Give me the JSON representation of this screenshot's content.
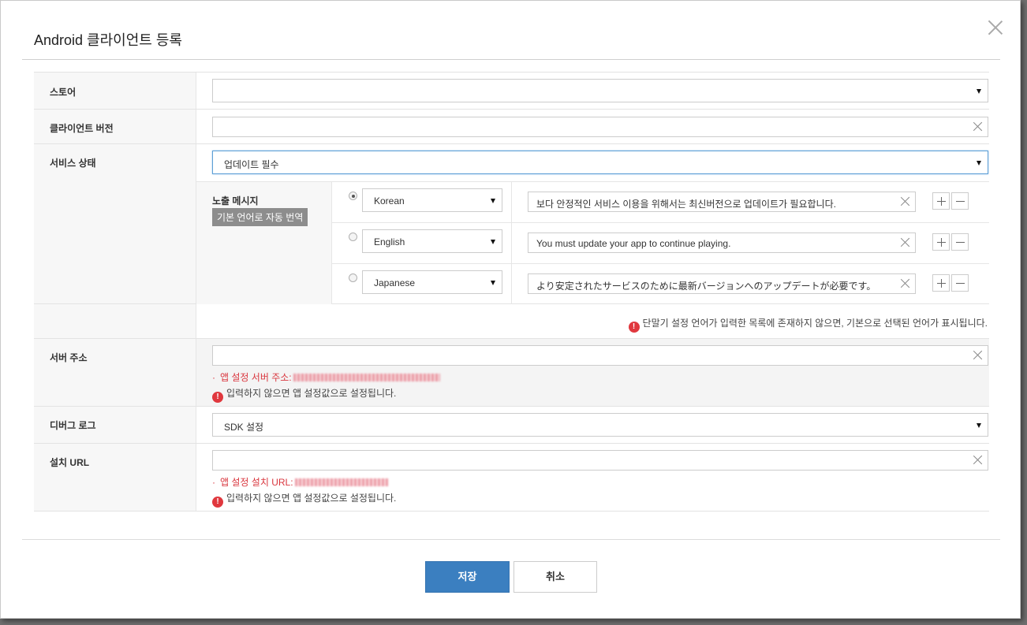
{
  "dialog": {
    "title": "Android 클라이언트 등록",
    "close_icon": "close-icon"
  },
  "fields": {
    "store": {
      "label": "스토어",
      "value": ""
    },
    "client_version": {
      "label": "클라이언트 버전",
      "value": ""
    },
    "service_status": {
      "label": "서비스 상태",
      "value": "업데이트 필수",
      "message_label": "노출 메시지",
      "auto_translate_badge": "기본 언어로 자동 번역",
      "messages": [
        {
          "language": "Korean",
          "text": "보다 안정적인 서비스 이용을 위해서는 최신버전으로 업데이트가 필요합니다.",
          "selected": true
        },
        {
          "language": "English",
          "text": "You must update your app to continue playing.",
          "selected": false
        },
        {
          "language": "Japanese",
          "text": "より安定されたサービスのために最新バージョンへのアップデートが必要です。",
          "selected": false
        }
      ],
      "language_notice": "단말기 설정 언어가 입력한 목록에 존재하지 않으면, 기본으로 선택된 언어가 표시됩니다."
    },
    "server_address": {
      "label": "서버 주소",
      "value": "",
      "hint_label": "앱 설정 서버 주소:",
      "notice": "입력하지 않으면 앱 설정값으로 설정됩니다."
    },
    "debug_log": {
      "label": "디버그 로그",
      "value": "SDK 설정"
    },
    "install_url": {
      "label": "설치 URL",
      "value": "",
      "hint_label": "앱 설정 설치 URL:",
      "notice": "입력하지 않으면 앱 설정값으로 설정됩니다."
    }
  },
  "buttons": {
    "save": "저장",
    "cancel": "취소"
  },
  "colors": {
    "primary": "#3b7fc0",
    "warning": "#e0383e",
    "label_bg": "#f7f7f7",
    "focus_border": "#5d9fd6"
  }
}
